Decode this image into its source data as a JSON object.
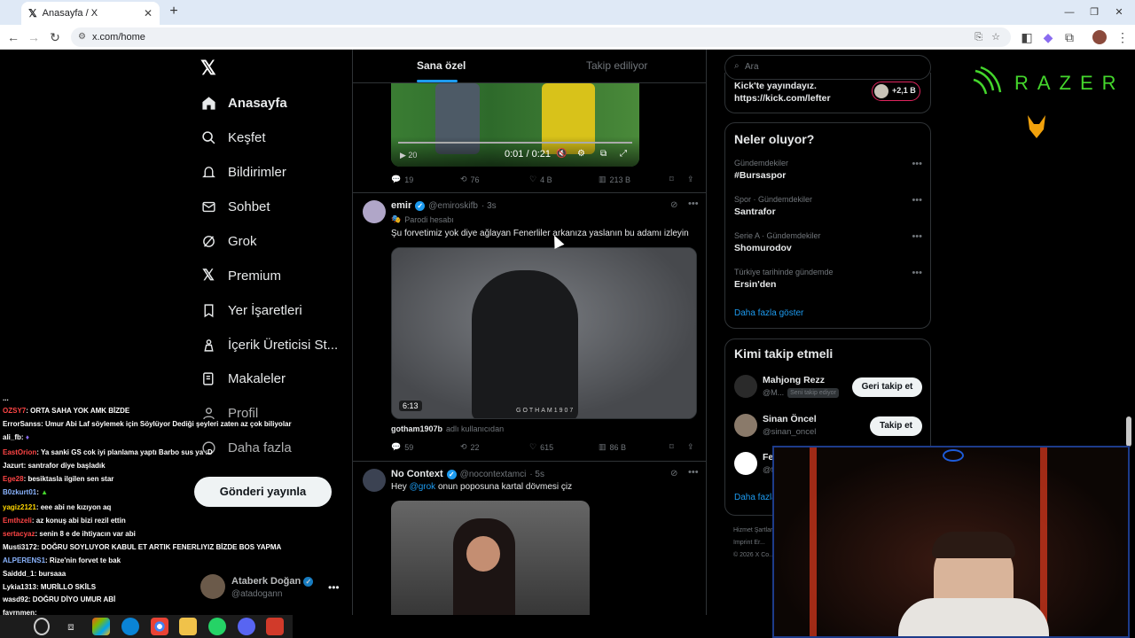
{
  "browser": {
    "tab_title": "Anasayfa / X",
    "url": "x.com/home",
    "new_tab": "+",
    "tab_close": "✕"
  },
  "sidebar": {
    "logo": "𝕏",
    "items": [
      {
        "label": "Anasayfa",
        "icon": "home-icon"
      },
      {
        "label": "Keşfet",
        "icon": "search-icon"
      },
      {
        "label": "Bildirimler",
        "icon": "bell-icon"
      },
      {
        "label": "Sohbet",
        "icon": "mail-icon"
      },
      {
        "label": "Grok",
        "icon": "grok-icon"
      },
      {
        "label": "Premium",
        "icon": "x-icon"
      },
      {
        "label": "Yer İşaretleri",
        "icon": "bookmark-icon"
      },
      {
        "label": "İçerik Üreticisi St...",
        "icon": "creator-icon"
      },
      {
        "label": "Makaleler",
        "icon": "article-icon"
      },
      {
        "label": "Profil",
        "icon": "person-icon"
      },
      {
        "label": "Daha fazla",
        "icon": "more-circle-icon"
      }
    ],
    "post_button": "Gönderi yayınla",
    "account": {
      "name": "Ataberk Doğan",
      "handle": "@atadogann"
    }
  },
  "feed": {
    "tabs": [
      "Sana özel",
      "Takip ediliyor"
    ],
    "video1": {
      "time": "0:01 / 0:21",
      "seek": "20"
    },
    "post0_actions": {
      "replies": "19",
      "reposts": "76",
      "likes": "4 B",
      "views": "213 B"
    },
    "post1": {
      "name": "emir",
      "handle": "@emiroskifb",
      "time": "· 3s",
      "label": "Parodi hesabı",
      "text": "Şu forvetimiz yok diye ağlayan Fenerliler arkanıza yaslanın bu adamı izleyin",
      "duration": "6:13",
      "watermark": "GOTHAM1907",
      "credit_user": "gotham1907b",
      "credit_suffix": "adlı kullanıcıdan",
      "actions": {
        "replies": "59",
        "reposts": "22",
        "likes": "615",
        "views": "86 B"
      }
    },
    "post2": {
      "name": "No Context",
      "handle": "@nocontextamci",
      "time": "· 5s",
      "mention": "@grok",
      "text": " onun poposuna kartal dövmesi çiz",
      "prefix": "Hey "
    }
  },
  "right": {
    "search_placeholder": "Ara",
    "live": {
      "line1": "Kick'te yayındayız.",
      "line2": "https://kick.com/lefter",
      "count": "+2,1 B"
    },
    "trends_title": "Neler oluyor?",
    "trends": [
      {
        "cat": "Gündemdekiler",
        "title": "#Bursaspor"
      },
      {
        "cat": "Spor · Gündemdekiler",
        "title": "Santrafor"
      },
      {
        "cat": "Serie A · Gündemdekiler",
        "title": "Shomurodov"
      },
      {
        "cat": "Türkiye tarihinde gündemde",
        "title": "Ersin'den"
      }
    ],
    "show_more": "Daha fazla göster",
    "who_title": "Kimi takip etmeli",
    "who": [
      {
        "name": "Mahjong Rezz",
        "handle": "@M...",
        "badge": "Seni takip ediyor",
        "btn": "Geri takip et"
      },
      {
        "name": "Sinan Öncel",
        "handle": "@sinan_oncel",
        "btn": "Takip et"
      },
      {
        "name": "Fe...",
        "handle": "@fe..."
      }
    ],
    "who_more": "Daha fazla",
    "footer": [
      "Hizmet Şartları",
      "Imprint",
      "Er...",
      "© 2026 X Co..."
    ]
  },
  "overlay": {
    "brand": "RAZER",
    "colors": {
      "razer": "#44d62c",
      "cam_border": "#1d3b8a",
      "x_blue": "#1d9bf0"
    }
  },
  "chat": [
    {
      "user": "...",
      "color": "#ffffff",
      "msg": ""
    },
    {
      "user": "OZSY7",
      "color": "#ff4545",
      "msg": ": ORTA SAHA YOK AMK BİZDE"
    },
    {
      "user": "ErrorSanss",
      "color": "#ffffff",
      "msg": ": Umur Abi Laf söylemek için Söylüyor Dediği şeyleri zaten az çok biliyolar"
    },
    {
      "user": "ali_fb",
      "color": "#ffffff",
      "msg": ":"
    },
    {
      "user": "EastOrion",
      "color": "#ff4545",
      "msg": ": Ya sanki GS cok iyi planlama yaptı Barbo sus ya :D"
    },
    {
      "user": "Jazurt",
      "color": "#ffffff",
      "msg": ": santrafor diye başladık"
    },
    {
      "user": "Ege28",
      "color": "#ff4545",
      "msg": ": besiktasla ilgilen sen star"
    },
    {
      "user": "B0zkurt01",
      "color": "#ffffff",
      "msg": ":"
    },
    {
      "user": "yagiz2121",
      "color": "#ffd700",
      "msg": ": eee abi ne kızıyon aq"
    },
    {
      "user": "Emthzeli",
      "color": "#ff4545",
      "msg": ": az konuş abi bizi rezil ettin"
    },
    {
      "user": "sertacyaz",
      "color": "#ff4545",
      "msg": ": senin 8 e de ihtiyacın var abi"
    },
    {
      "user": "Musti3172",
      "color": "#ffffff",
      "msg": ": DOĞRU SOYLUYOR KABUL ET ARTIK FENERLIYIZ BİZDE BOS YAPMA"
    },
    {
      "user": "ALPERENS1",
      "color": "#8ab4ff",
      "msg": ": Rize'nin forvet te bak"
    },
    {
      "user": "Saiddd_1",
      "color": "#ffffff",
      "msg": ": bursaaa"
    },
    {
      "user": "Lykia1313",
      "color": "#ffffff",
      "msg": ": MURİLLO SKİLS"
    },
    {
      "user": "wasd92",
      "color": "#ffffff",
      "msg": ": DOĞRU DİYO UMUR ABİ"
    },
    {
      "user": "fayrnmen",
      "color": "#ffffff",
      "msg": ":"
    }
  ]
}
